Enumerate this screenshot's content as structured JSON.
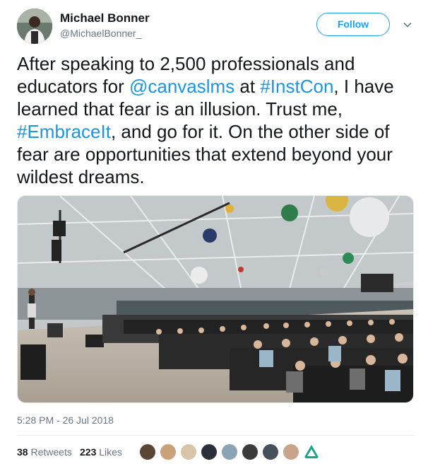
{
  "author": {
    "name": "Michael Bonner",
    "handle": "@MichaelBonner_"
  },
  "follow_label": "Follow",
  "tweet": {
    "part1": "After speaking to 2,500 professionals and educators for ",
    "mention": "@canvaslms",
    "part2": " at ",
    "hashtag1": "#InstCon",
    "part3": ", I have learned that fear is an illusion. Trust me, ",
    "hashtag2": "#EmbraceIt",
    "part4": ", and go for it. On the other side of fear are opportunities that extend beyond your wildest dreams."
  },
  "timestamp": "5:28 PM - 26 Jul 2018",
  "stats": {
    "retweets_count": "38",
    "retweets_label": "Retweets",
    "likes_count": "223",
    "likes_label": "Likes"
  },
  "colors": {
    "link": "#1b95e0",
    "follow": "#1da1f2",
    "secondary_text": "#657786"
  },
  "icons": {
    "caret": "chevron-down-icon"
  },
  "liker_count": 9
}
